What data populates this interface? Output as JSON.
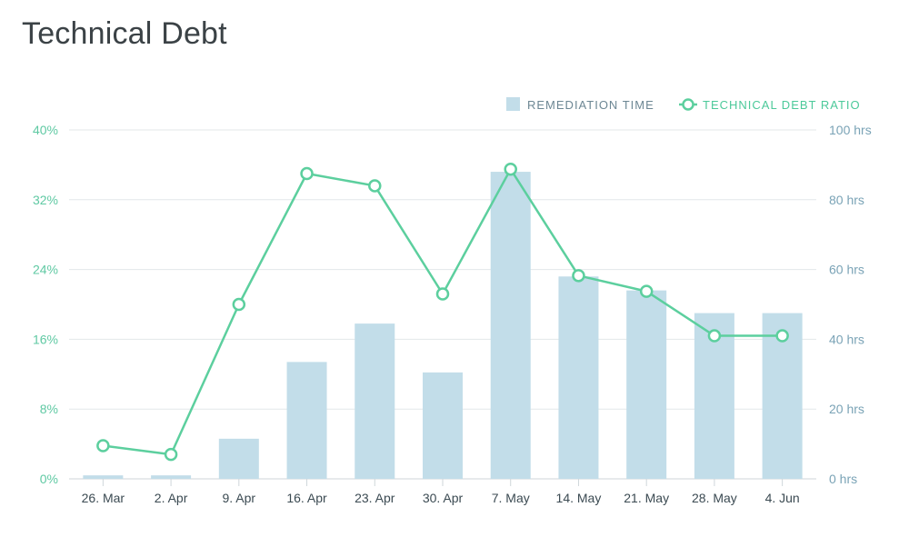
{
  "title": "Technical Debt",
  "colors": {
    "bar": "#c2dde9",
    "line": "#5ccf9e",
    "grid": "#e3e7ea",
    "left_tick": "#5fc9a3",
    "right_tick": "#7aa3b6",
    "legend_bar_text": "#6d8794",
    "legend_line_text": "#4cc99a"
  },
  "chart_data": {
    "type": "bar",
    "title": "Technical Debt",
    "categories": [
      "26. Mar",
      "2. Apr",
      "9. Apr",
      "16. Apr",
      "23. Apr",
      "30. Apr",
      "7. May",
      "14. May",
      "21. May",
      "28. May",
      "4. Jun"
    ],
    "series": [
      {
        "name": "REMEDIATION TIME",
        "type": "bar",
        "axis": "right",
        "values": [
          1,
          1,
          11.5,
          33.5,
          44.5,
          30.5,
          88,
          58,
          54,
          47.5,
          47.5
        ]
      },
      {
        "name": "TECHNICAL DEBT RATIO",
        "type": "line",
        "axis": "left",
        "values": [
          3.8,
          2.8,
          20.0,
          35.0,
          33.6,
          21.2,
          35.5,
          23.3,
          21.5,
          16.4,
          16.4
        ]
      }
    ],
    "left_axis": {
      "ylim": [
        0,
        40
      ],
      "ticks": [
        "0%",
        "8%",
        "16%",
        "24%",
        "32%",
        "40%"
      ]
    },
    "right_axis": {
      "ylim": [
        0,
        100
      ],
      "ticks": [
        "0 hrs",
        "20 hrs",
        "40 hrs",
        "60 hrs",
        "80 hrs",
        "100 hrs"
      ]
    },
    "grid": true,
    "legend_position": "top-right"
  }
}
